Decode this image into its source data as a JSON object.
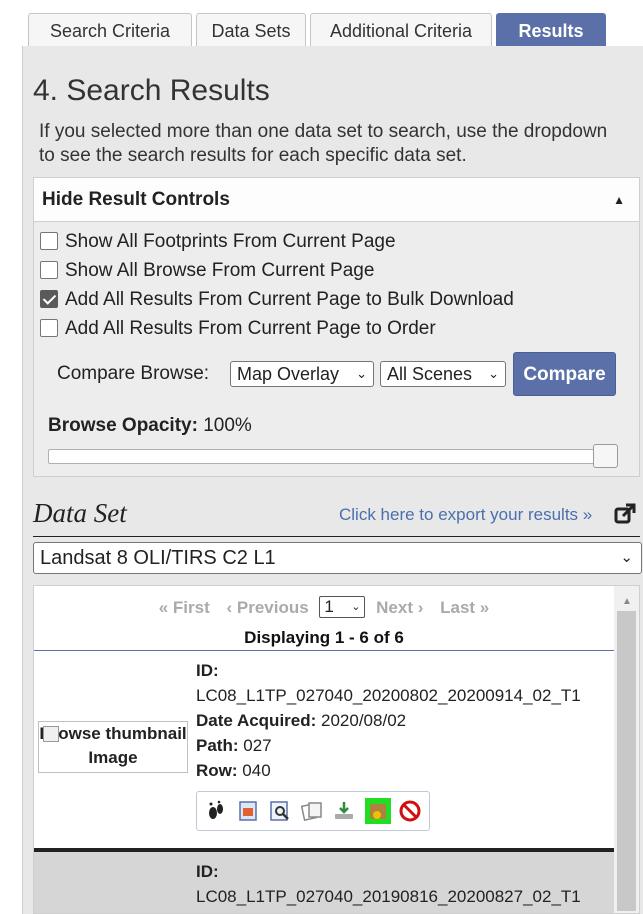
{
  "tabs": [
    {
      "label": "Search Criteria"
    },
    {
      "label": "Data Sets"
    },
    {
      "label": "Additional Criteria"
    },
    {
      "label": "Results"
    }
  ],
  "title": "4. Search Results",
  "intro": "If you selected more than one data set to search, use the dropdown to see the search results for each specific data set.",
  "controls": {
    "header": "Hide Result Controls",
    "checkboxes": [
      {
        "label": "Show All Footprints From Current Page",
        "checked": false
      },
      {
        "label": "Show All Browse From Current Page",
        "checked": false
      },
      {
        "label": "Add All Results From Current Page to Bulk Download",
        "checked": true
      },
      {
        "label": "Add All Results From Current Page to Order",
        "checked": false
      }
    ],
    "compare_label": "Compare Browse:",
    "overlay_select": "Map Overlay",
    "scenes_select": "All Scenes",
    "compare_button": "Compare",
    "opacity_label": "Browse Opacity:",
    "opacity_value": "100%",
    "opacity_level": 1.0
  },
  "dataset": {
    "title": "Data Set",
    "export_link": "Click here to export your results »",
    "selected": "Landsat 8 OLI/TIRS C2 L1"
  },
  "results": {
    "pager": {
      "first": "« First",
      "previous": "‹ Previous",
      "page": "1",
      "next": "Next ›",
      "last": "Last »"
    },
    "displaying": "Displaying 1 - 6 of 6",
    "thumb_alt": "Browse thumbnail Image",
    "labels": {
      "id": "ID:",
      "date": "Date Acquired:",
      "path": "Path:",
      "row": "Row:"
    },
    "items": [
      {
        "id": "LC08_L1TP_027040_20200802_20200914_02_T1",
        "date": "2020/08/02",
        "path": "027",
        "row": "040"
      },
      {
        "id": "LC08_L1TP_027040_20190816_20200827_02_T1"
      }
    ],
    "action_icons": [
      "footprint-icon",
      "browse-overlay-icon",
      "metadata-icon",
      "compare-icon",
      "download-icon",
      "bulk-download-icon",
      "exclude-icon"
    ]
  }
}
